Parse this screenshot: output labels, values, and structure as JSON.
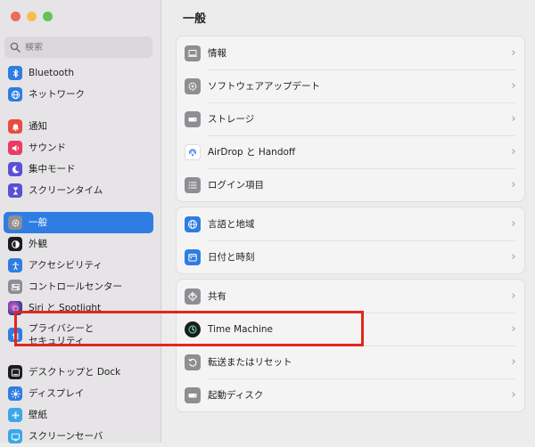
{
  "window": {
    "traffic_lights": {
      "close": "#ed6a5e",
      "minimize": "#f5bf4f",
      "zoom": "#61c554"
    }
  },
  "search": {
    "placeholder": "検索",
    "icon": "search-icon"
  },
  "sidebar": {
    "items": [
      {
        "label": "Bluetooth",
        "icon": "bluetooth-icon",
        "color": "#2f7de3"
      },
      {
        "label": "ネットワーク",
        "icon": "globe-icon",
        "color": "#2f7de3"
      },
      {
        "label": "通知",
        "icon": "bell-icon",
        "color": "#eb4b3d"
      },
      {
        "label": "サウンド",
        "icon": "speaker-icon",
        "color": "#eb3b64"
      },
      {
        "label": "集中モード",
        "icon": "moon-icon",
        "color": "#5a4fd6"
      },
      {
        "label": "スクリーンタイム",
        "icon": "hourglass-icon",
        "color": "#5a4fd6"
      },
      {
        "label": "一般",
        "icon": "gear-icon",
        "color": "#8e8e93",
        "selected": true
      },
      {
        "label": "外観",
        "icon": "appearance-icon",
        "color": "#1c1c1e"
      },
      {
        "label": "アクセシビリティ",
        "icon": "accessibility-icon",
        "color": "#2f7de3"
      },
      {
        "label": "コントロールセンター",
        "icon": "control-center-icon",
        "color": "#8e8e93"
      },
      {
        "label": "Siri と Spotlight",
        "icon": "siri-icon",
        "color": "#3a3a8c"
      },
      {
        "label": "プライバシーと\nセキュリティ",
        "icon": "hand-icon",
        "color": "#2f7de3"
      },
      {
        "label": "デスクトップと Dock",
        "icon": "dock-icon",
        "color": "#1c1c1e"
      },
      {
        "label": "ディスプレイ",
        "icon": "sun-icon",
        "color": "#2f7de3"
      },
      {
        "label": "壁紙",
        "icon": "wallpaper-icon",
        "color": "#3aa7e8"
      },
      {
        "label": "スクリーンセーバ",
        "icon": "screensaver-icon",
        "color": "#3aa7e8"
      }
    ]
  },
  "main": {
    "title": "一般",
    "groups": [
      {
        "rows": [
          {
            "label": "情報",
            "icon": "laptop-icon",
            "color": "#8e8e93"
          },
          {
            "label": "ソフトウェアアップデート",
            "icon": "software-update-icon",
            "color": "#8e8e93"
          },
          {
            "label": "ストレージ",
            "icon": "storage-icon",
            "color": "#8e8e93"
          },
          {
            "label": "AirDrop と Handoff",
            "icon": "airdrop-icon",
            "color": "#ffffff"
          },
          {
            "label": "ログイン項目",
            "icon": "list-icon",
            "color": "#8e8e93"
          }
        ]
      },
      {
        "rows": [
          {
            "label": "言語と地域",
            "icon": "globe-icon",
            "color": "#2f7de3"
          },
          {
            "label": "日付と時刻",
            "icon": "calendar-icon",
            "color": "#2f7de3"
          }
        ]
      },
      {
        "rows": [
          {
            "label": "共有",
            "icon": "sharing-icon",
            "color": "#8e8e93"
          },
          {
            "label": "Time Machine",
            "icon": "time-machine-icon",
            "color": "#1c1c1e",
            "highlighted": true
          },
          {
            "label": "転送またはリセット",
            "icon": "reset-icon",
            "color": "#8e8e93"
          },
          {
            "label": "起動ディスク",
            "icon": "disk-icon",
            "color": "#8e8e93"
          }
        ]
      }
    ],
    "chevron": "›",
    "highlight_color": "#e2261c"
  }
}
